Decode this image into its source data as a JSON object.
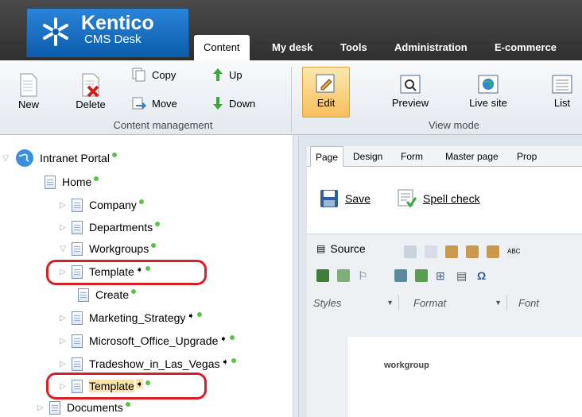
{
  "app": {
    "brand": "Kentico",
    "product": "CMS Desk"
  },
  "main_tabs": [
    {
      "label": "Content",
      "active": true
    },
    {
      "label": "My desk"
    },
    {
      "label": "Tools"
    },
    {
      "label": "Administration"
    },
    {
      "label": "E-commerce"
    }
  ],
  "toolbar": {
    "new": "New",
    "delete": "Delete",
    "copy": "Copy",
    "move": "Move",
    "up": "Up",
    "down": "Down",
    "content_group": "Content management",
    "edit": "Edit",
    "preview": "Preview",
    "live_site": "Live site",
    "list": "List",
    "view_group": "View mode"
  },
  "tree": {
    "root": "Intranet Portal",
    "items": [
      {
        "label": "Home"
      },
      {
        "label": "Company"
      },
      {
        "label": "Departments"
      },
      {
        "label": "Workgroups"
      },
      {
        "label": "Template"
      },
      {
        "label": "Create"
      },
      {
        "label": "Marketing_Strategy"
      },
      {
        "label": "Microsoft_Office_Upgrade"
      },
      {
        "label": "Tradeshow_in_Las_Vegas"
      },
      {
        "label": "Template"
      },
      {
        "label": "Documents"
      }
    ]
  },
  "page_tabs": [
    "Page",
    "Design",
    "Form",
    "Master page",
    "Prop"
  ],
  "actions": {
    "save": "Save",
    "spell_check": "Spell check"
  },
  "editor": {
    "source": "Source",
    "styles": "Styles",
    "format": "Format",
    "font": "Font",
    "body_text": "workgroup"
  },
  "colors": {
    "status_dot": "#5cc34a",
    "highlight_border": "#d81f27",
    "selected_bg": "#fbe3a8"
  }
}
